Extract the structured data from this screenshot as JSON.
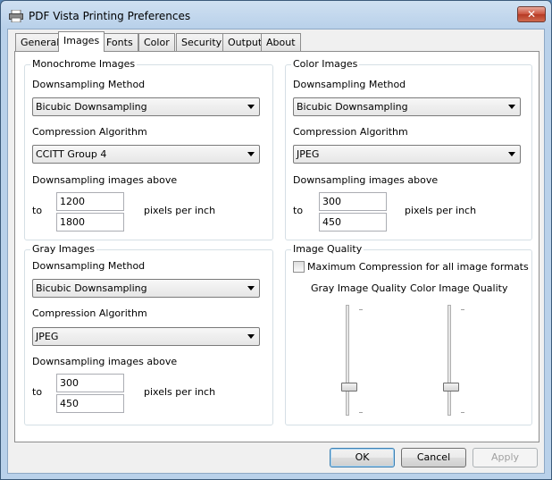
{
  "window": {
    "title": "PDF Vista Printing Preferences",
    "close_label": "✕"
  },
  "tabs": [
    {
      "label": "General"
    },
    {
      "label": "Images"
    },
    {
      "label": "Fonts"
    },
    {
      "label": "Color"
    },
    {
      "label": "Security"
    },
    {
      "label": "Output"
    },
    {
      "label": "About"
    }
  ],
  "active_tab": "Images",
  "monochrome": {
    "title": "Monochrome Images",
    "downsampling_label": "Downsampling Method",
    "downsampling_value": "Bicubic Downsampling",
    "compression_label": "Compression Algorithm",
    "compression_value": "CCITT Group 4",
    "above_label": "Downsampling images above",
    "to_label": "to",
    "above_value": "1200",
    "to_value": "1800",
    "unit_label": "pixels per inch"
  },
  "color": {
    "title": "Color Images",
    "downsampling_label": "Downsampling Method",
    "downsampling_value": "Bicubic Downsampling",
    "compression_label": "Compression Algorithm",
    "compression_value": "JPEG",
    "above_label": "Downsampling images above",
    "to_label": "to",
    "above_value": "300",
    "to_value": "450",
    "unit_label": "pixels per inch"
  },
  "gray": {
    "title": "Gray Images",
    "downsampling_label": "Downsampling Method",
    "downsampling_value": "Bicubic Downsampling",
    "compression_label": "Compression Algorithm",
    "compression_value": "JPEG",
    "above_label": "Downsampling images above",
    "to_label": "to",
    "above_value": "300",
    "to_value": "450",
    "unit_label": "pixels per inch"
  },
  "quality": {
    "title": "Image Quality",
    "max_compression_label": "Maximum Compression for all image formats",
    "max_compression_checked": false,
    "gray_label": "Gray Image Quality",
    "color_label": "Color Image Quality",
    "gray_level": 0.2,
    "color_level": 0.2
  },
  "buttons": {
    "ok": "OK",
    "cancel": "Cancel",
    "apply": "Apply"
  }
}
